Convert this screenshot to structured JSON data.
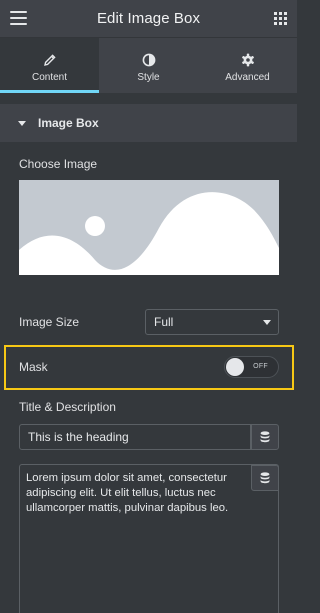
{
  "header": {
    "title": "Edit Image Box",
    "menu_icon": "hamburger-menu-icon",
    "apps_icon": "grid-apps-icon"
  },
  "tabs": [
    {
      "label": "Content",
      "icon": "pencil-icon",
      "active": true
    },
    {
      "label": "Style",
      "icon": "half-circle-icon",
      "active": false
    },
    {
      "label": "Advanced",
      "icon": "gear-icon",
      "active": false
    }
  ],
  "section": {
    "title": "Image Box"
  },
  "choose_image": {
    "label": "Choose Image"
  },
  "image_size": {
    "label": "Image Size",
    "value": "Full"
  },
  "mask": {
    "label": "Mask",
    "toggle_state": "OFF"
  },
  "title_description": {
    "label": "Title & Description",
    "heading_value": "This is the heading",
    "description_value": "Lorem ipsum dolor sit amet, consectetur adipiscing elit. Ut elit tellus, luctus nec ullamcorper mattis, pulvinar dapibus leo."
  },
  "colors": {
    "accent": "#71d7f7",
    "highlight_border": "#f7c815",
    "panel_bg": "#34383c",
    "header_bg": "#404349"
  }
}
